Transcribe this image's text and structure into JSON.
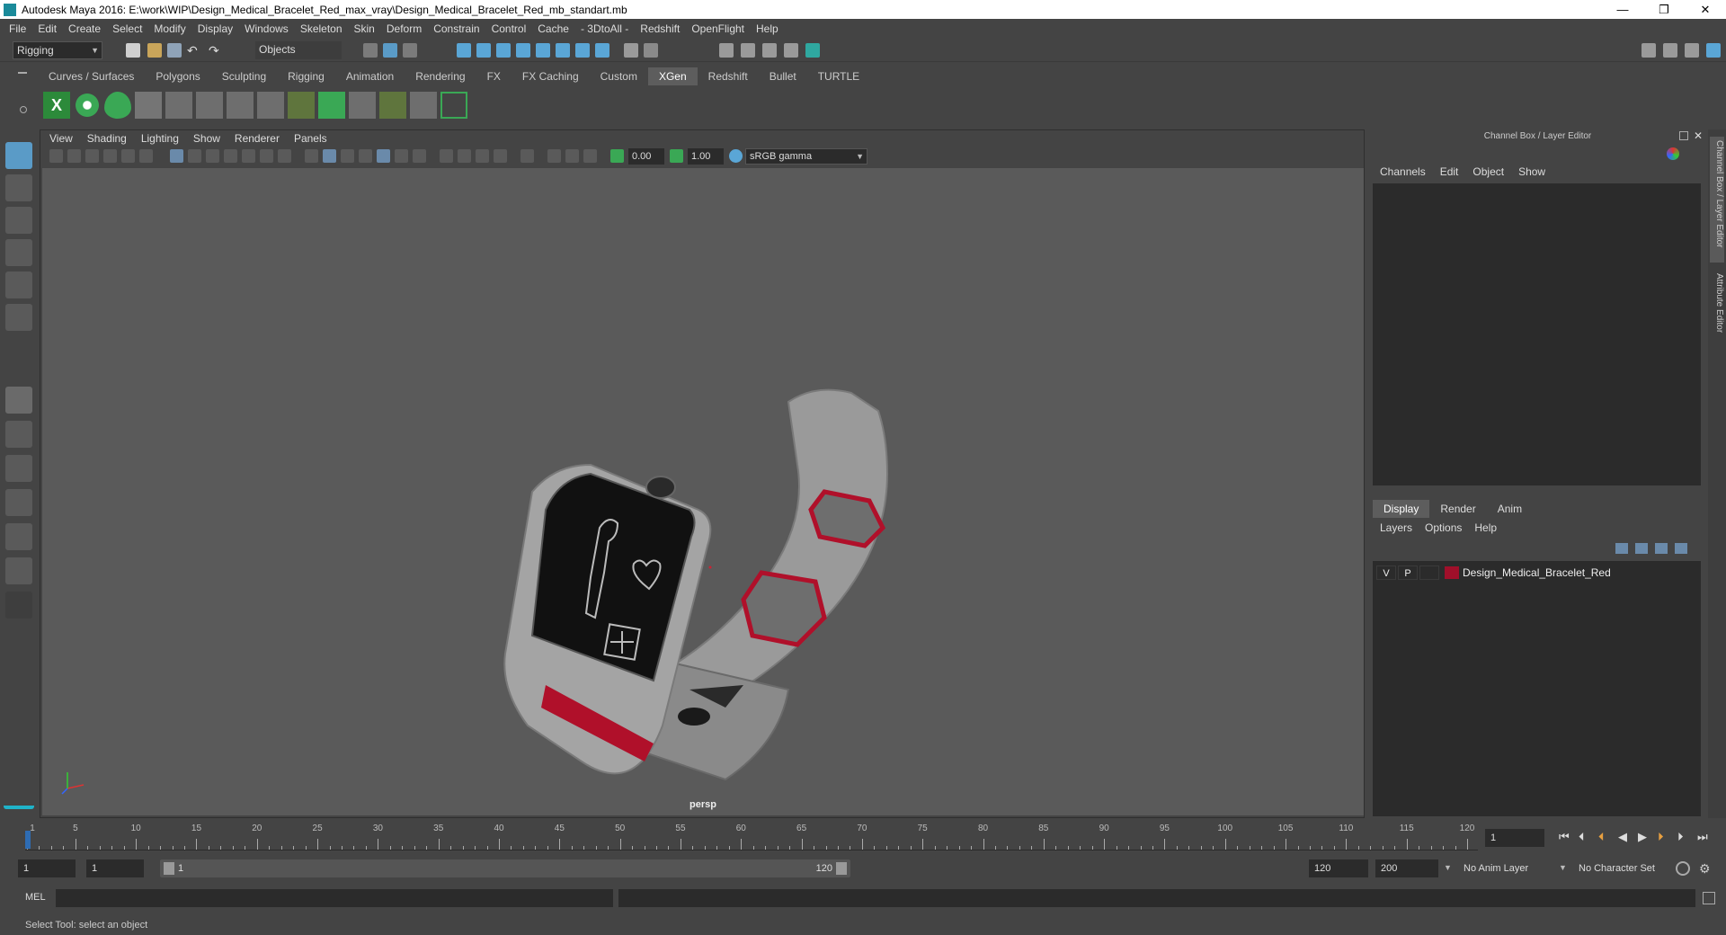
{
  "window": {
    "title": "Autodesk Maya 2016: E:\\work\\WIP\\Design_Medical_Bracelet_Red_max_vray\\Design_Medical_Bracelet_Red_mb_standart.mb",
    "minimize": "—",
    "maximize": "❐",
    "close": "✕"
  },
  "menubar": [
    "File",
    "Edit",
    "Create",
    "Select",
    "Modify",
    "Display",
    "Windows",
    "Skeleton",
    "Skin",
    "Deform",
    "Constrain",
    "Control",
    "Cache",
    "- 3DtoAll -",
    "Redshift",
    "OpenFlight",
    "Help"
  ],
  "statusline": {
    "menuset": "Rigging",
    "selection_mask": "Objects"
  },
  "shelf": {
    "tabs": [
      "Curves / Surfaces",
      "Polygons",
      "Sculpting",
      "Rigging",
      "Animation",
      "Rendering",
      "FX",
      "FX Caching",
      "Custom",
      "XGen",
      "Redshift",
      "Bullet",
      "TURTLE"
    ],
    "active_tab": "XGen"
  },
  "viewport": {
    "menus": [
      "View",
      "Shading",
      "Lighting",
      "Show",
      "Renderer",
      "Panels"
    ],
    "exposure": "0.00",
    "gamma": "1.00",
    "color_space": "sRGB gamma",
    "camera_label": "persp"
  },
  "channel_box": {
    "title": "Channel Box / Layer Editor",
    "menus": [
      "Channels",
      "Edit",
      "Object",
      "Show"
    ]
  },
  "layer_editor": {
    "tabs": [
      "Display",
      "Render",
      "Anim"
    ],
    "active_tab": "Display",
    "menus": [
      "Layers",
      "Options",
      "Help"
    ],
    "layers": [
      {
        "visible": "V",
        "playback": "P",
        "color": "#a00f2a",
        "name": "Design_Medical_Bracelet_Red"
      }
    ]
  },
  "side_tabs": [
    "Channel Box / Layer Editor",
    "Attribute Editor"
  ],
  "timeline": {
    "ticks": [
      1,
      5,
      10,
      15,
      20,
      25,
      30,
      35,
      40,
      45,
      50,
      55,
      60,
      65,
      70,
      75,
      80,
      85,
      90,
      95,
      100,
      105,
      110,
      115,
      120
    ],
    "current_frame": "1"
  },
  "range": {
    "start": "1",
    "playback_start": "1",
    "slider_start": "1",
    "slider_end": "120",
    "playback_end": "120",
    "end": "200",
    "anim_layer": "No Anim Layer",
    "character_set": "No Character Set"
  },
  "command_line": {
    "label": "MEL"
  },
  "help_line": "Select Tool: select an object",
  "colors": {
    "accent": "#5ab4d6",
    "bracelet_red": "#b0102a",
    "bracelet_body": "#9a9a9a",
    "screen_black": "#111111"
  }
}
